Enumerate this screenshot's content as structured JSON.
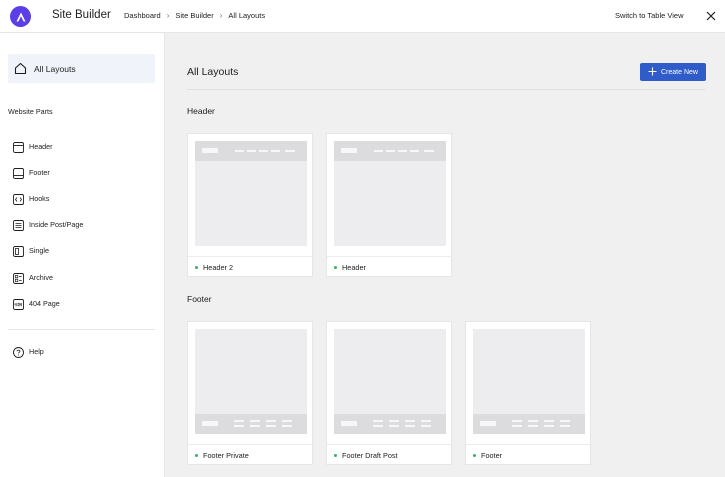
{
  "header": {
    "app_title": "Site Builder",
    "breadcrumbs": [
      "Dashboard",
      "Site Builder",
      "All Layouts"
    ],
    "switch_view_label": "Switch to Table View",
    "brand_color": "#5b3ee6"
  },
  "sidebar": {
    "active_item": "All Layouts",
    "section_title": "Website Parts",
    "items": [
      {
        "label": "Header",
        "icon": "header-icon"
      },
      {
        "label": "Footer",
        "icon": "footer-icon"
      },
      {
        "label": "Hooks",
        "icon": "code-icon"
      },
      {
        "label": "Inside Post/Page",
        "icon": "post-icon"
      },
      {
        "label": "Single",
        "icon": "single-icon"
      },
      {
        "label": "Archive",
        "icon": "archive-icon"
      },
      {
        "label": "404 Page",
        "icon": "404-icon"
      }
    ],
    "help_label": "Help"
  },
  "main": {
    "title": "All Layouts",
    "create_button_label": "Create New",
    "accent_color": "#2f5cc8",
    "status_color": "#3fae6a",
    "sections": [
      {
        "title": "Header",
        "cards": [
          "Header 2",
          "Header"
        ]
      },
      {
        "title": "Footer",
        "cards": [
          "Footer Private",
          "Footer Draft Post",
          "Footer"
        ]
      }
    ]
  }
}
